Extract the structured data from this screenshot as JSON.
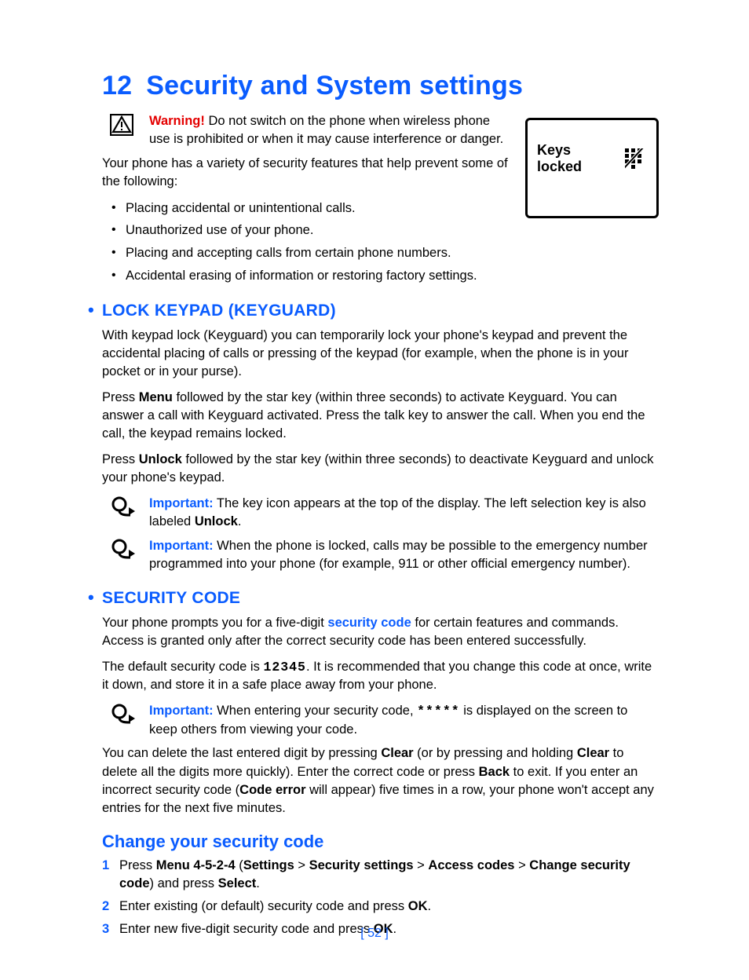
{
  "chapter": {
    "number": "12",
    "title": "Security and System settings"
  },
  "warning": {
    "lead": "Warning!",
    "text": " Do not switch on the phone when wireless phone use is prohibited or when it may cause interference or danger."
  },
  "phone_screen": {
    "label": "Keys locked"
  },
  "intro": "Your phone has a variety of security features that help prevent some of the following:",
  "feature_bullets": [
    "Placing accidental or unintentional calls.",
    "Unauthorized use of your phone.",
    "Placing and accepting calls from certain phone numbers.",
    "Accidental erasing of information or restoring factory settings."
  ],
  "keyguard": {
    "heading": "LOCK KEYPAD (KEYGUARD)",
    "p1": "With keypad lock (Keyguard) you can temporarily lock your phone's keypad and prevent the accidental placing of calls or pressing of the keypad (for example, when the phone is in your pocket or in your purse).",
    "p2_a": "Press ",
    "p2_b": "Menu",
    "p2_c": " followed by the star key (within three seconds) to activate Keyguard. You can answer a call with Keyguard activated. Press the talk key to answer the call. When you end the call, the keypad remains locked.",
    "p3_a": "Press ",
    "p3_b": "Unlock",
    "p3_c": " followed by the star key (within three seconds) to deactivate Keyguard and unlock your phone's keypad.",
    "imp1": {
      "lead": "Important:",
      "a": " The key icon appears at the top of the display. The left selection key is also labeled ",
      "b": "Unlock",
      "c": "."
    },
    "imp2": {
      "lead": "Important:",
      "text": " When the phone is locked, calls may be possible to the emergency number programmed into your phone (for example, 911 or other official emergency number)."
    }
  },
  "security": {
    "heading": "SECURITY CODE",
    "p1_a": "Your phone prompts you for a five-digit ",
    "p1_link": "security code",
    "p1_b": " for certain features and commands. Access is granted only after the correct security code has been entered successfully.",
    "p2_a": "The default security code is ",
    "p2_code": "12345",
    "p2_b": ". It is recommended that you change this code at once, write it down, and store it in a safe place away from your phone.",
    "imp": {
      "lead": "Important:",
      "a": " When entering your security code, ",
      "stars": "*****",
      "b": " is displayed on the screen to keep others from viewing your code."
    },
    "p3_a": "You can delete the last entered digit by pressing ",
    "p3_b": "Clear",
    "p3_c": " (or by pressing and holding ",
    "p3_d": "Clear",
    "p3_e": " to delete all the digits more quickly). Enter the correct code or press ",
    "p3_f": "Back",
    "p3_g": " to exit. If you enter an incorrect security code (",
    "p3_h": "Code error",
    "p3_i": " will appear) five times in a row, your phone won't accept any entries for the next five minutes."
  },
  "change": {
    "heading": "Change your security code",
    "s1_a": "Press ",
    "s1_b": "Menu 4-5-2-4",
    "s1_c": " (",
    "s1_d": "Settings",
    "s1_e": " > ",
    "s1_f": "Security settings",
    "s1_g": " > ",
    "s1_h": "Access codes",
    "s1_i": " > ",
    "s1_j": "Change security code",
    "s1_k": ") and press ",
    "s1_l": "Select",
    "s1_m": ".",
    "s2_a": "Enter existing (or default) security code and press ",
    "s2_b": "OK",
    "s2_c": ".",
    "s3_a": "Enter new five-digit security code and press ",
    "s3_b": "OK",
    "s3_c": "."
  },
  "page_number": "[ 52 ]"
}
